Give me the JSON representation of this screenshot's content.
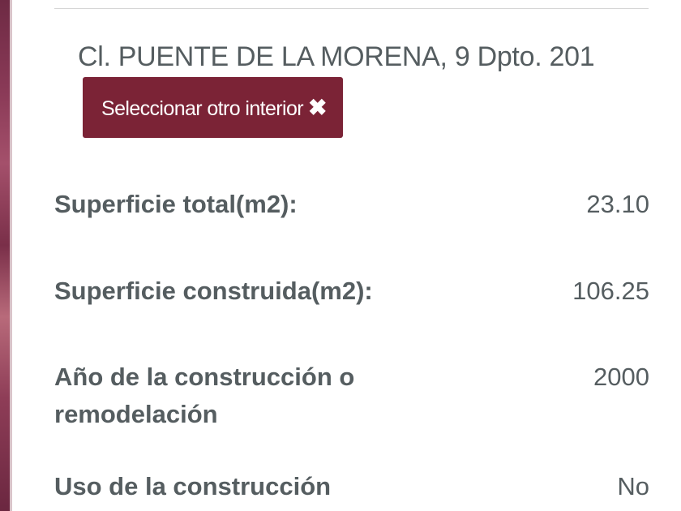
{
  "address": {
    "line": "Cl. PUENTE DE LA MORENA, 9 Dpto. 201"
  },
  "buttons": {
    "select_other_interior": "Seleccionar otro interior",
    "close_glyph": "✖"
  },
  "colors": {
    "button_bg": "#7b2336",
    "text": "#555d60",
    "map_accent": "#8a3a57"
  },
  "details": [
    {
      "label": "Superficie total(m2):",
      "value": "23.10"
    },
    {
      "label": "Superficie construida(m2):",
      "value": "106.25"
    },
    {
      "label": "Año de la construcción o remodelación",
      "value": "2000"
    },
    {
      "label": "Uso de la construcción",
      "value": "No"
    }
  ]
}
